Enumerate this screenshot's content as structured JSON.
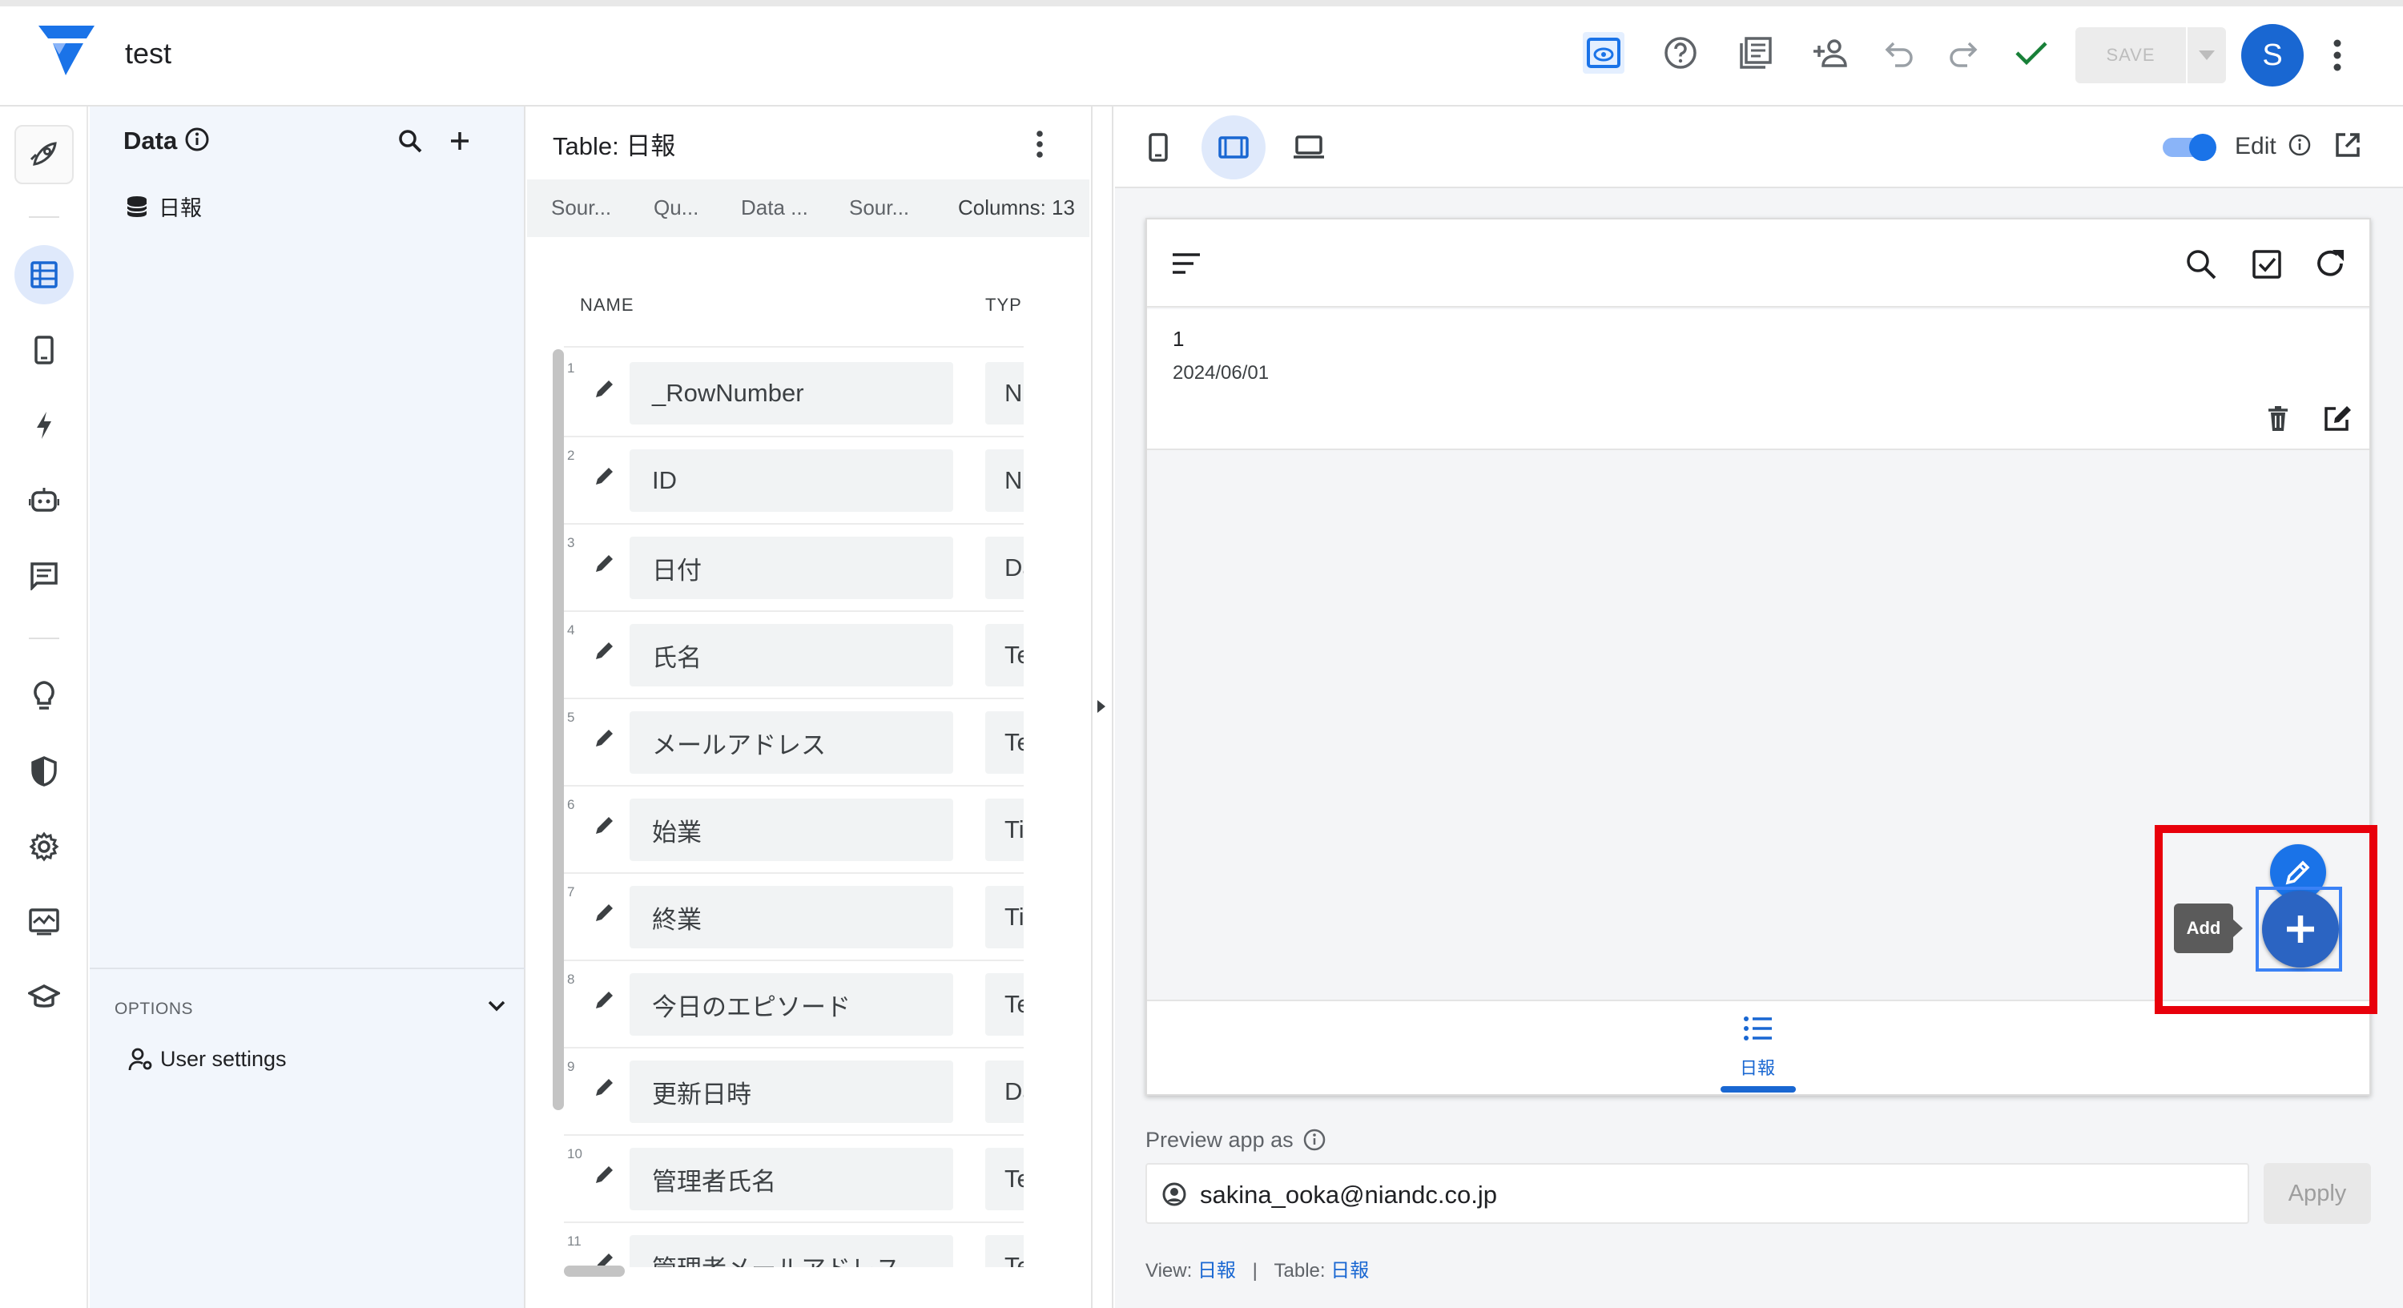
{
  "app": {
    "title": "test"
  },
  "toolbar": {
    "save_label": "SAVE",
    "avatar_initial": "S"
  },
  "data_panel": {
    "title": "Data",
    "tables": [
      {
        "label": "日報"
      }
    ],
    "options_label": "OPTIONS",
    "user_settings_label": "User settings"
  },
  "table_panel": {
    "title": "Table: 日報",
    "subtabs": [
      "Sour...",
      "Qu...",
      "Data ...",
      "Sour...",
      "Columns: 13"
    ],
    "headers": {
      "name": "NAME",
      "type": "TYP"
    },
    "columns": [
      {
        "num": "1",
        "name": "_RowNumber",
        "type": "N"
      },
      {
        "num": "2",
        "name": "ID",
        "type": "N"
      },
      {
        "num": "3",
        "name": "日付",
        "type": "Da"
      },
      {
        "num": "4",
        "name": "氏名",
        "type": "Te"
      },
      {
        "num": "5",
        "name": "メールアドレス",
        "type": "Te"
      },
      {
        "num": "6",
        "name": "始業",
        "type": "Ti"
      },
      {
        "num": "7",
        "name": "終業",
        "type": "Ti"
      },
      {
        "num": "8",
        "name": "今日のエピソード",
        "type": "Te"
      },
      {
        "num": "9",
        "name": "更新日時",
        "type": "Da"
      },
      {
        "num": "10",
        "name": "管理者氏名",
        "type": "Te"
      },
      {
        "num": "11",
        "name": "管理者メールアドレス",
        "type": "Te"
      }
    ]
  },
  "preview": {
    "edit_label": "Edit",
    "record": {
      "id": "1",
      "date": "2024/06/01"
    },
    "nav_label": "日報",
    "fab_tooltip": "Add",
    "preview_as_label": "Preview app as",
    "email_value": "sakina_ooka@niandc.co.jp",
    "apply_label": "Apply",
    "footer": {
      "view_label": "View:",
      "view_value": "日報",
      "sep": "|",
      "table_label": "Table:",
      "table_value": "日報"
    }
  },
  "colors": {
    "accent": "#1a73e8",
    "highlight": "#e8000b",
    "fab": "#2b64c2",
    "check": "#188038"
  }
}
